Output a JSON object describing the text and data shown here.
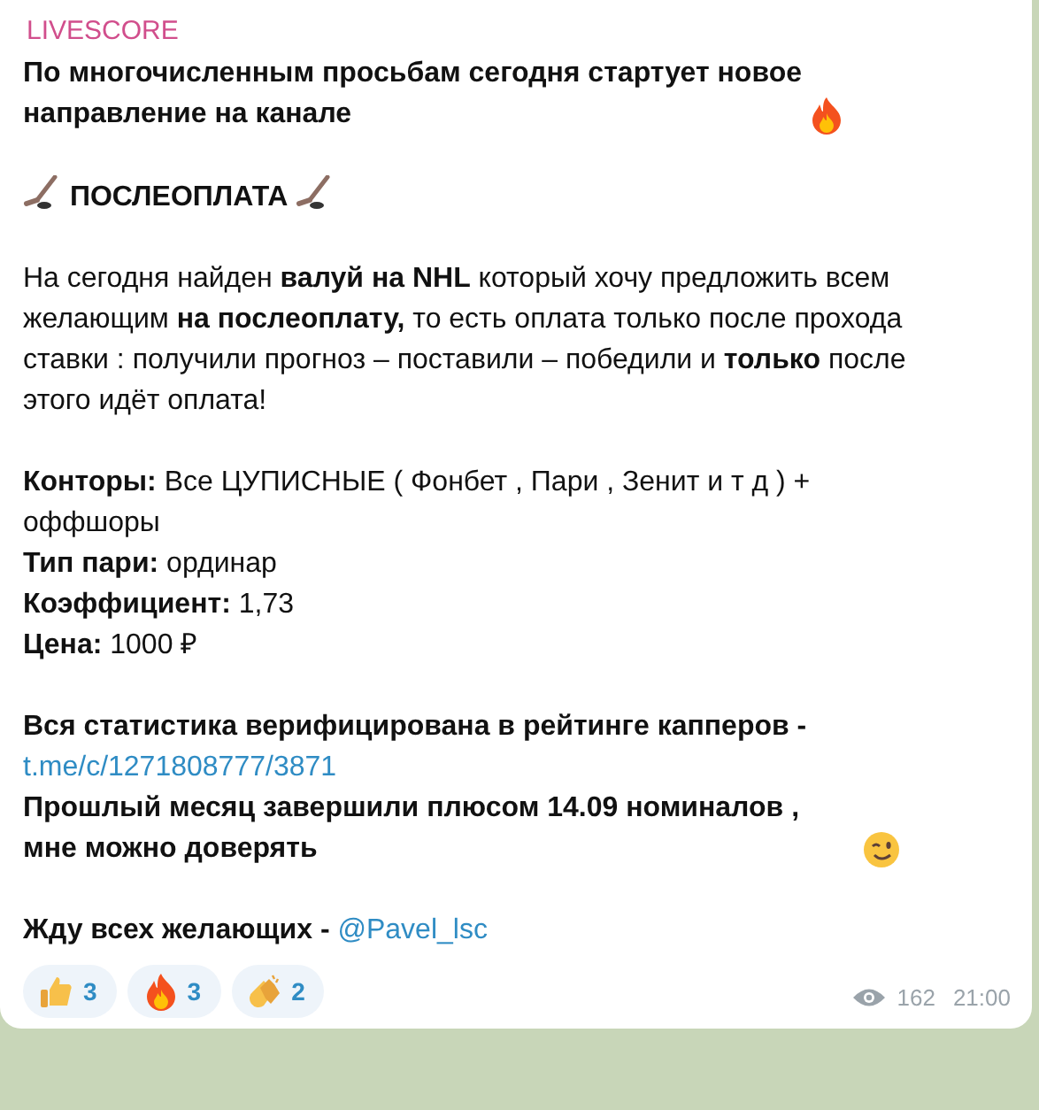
{
  "channel": {
    "name": "LIVESCORE"
  },
  "blocks": [
    {
      "kind": "headline",
      "text": "По многочисленным просьбам  сегодня стартует новое направление на канале"
    },
    {
      "kind": "banner",
      "text": "ПОСЛЕОПЛАТА"
    },
    {
      "kind": "para",
      "text": "На сегодня найден **валуй на NHL** который хочу предложить всем желающим **на послеоплату,** то есть оплата только после прохода ставки : получили прогноз – поставили – победили и **только** после этого идёт оплата!"
    },
    {
      "kind": "fields",
      "items": [
        {
          "label": "Конторы:",
          "value": "Все ЦУПИСНЫЕ ( Фонбет  , Пари , Зенит и т д ) + оффшоры"
        },
        {
          "label": "Тип пари:",
          "value": "ординар"
        },
        {
          "label": "Коэффициент:",
          "value": " 1,73"
        },
        {
          "label": "Цена:",
          "value": "1000 ₽"
        }
      ]
    },
    {
      "kind": "stats",
      "text": "Вся статистика верифицирована в рейтинге капперов -",
      "link": "t.me/c/1271808777/3871",
      "text2": "Прошлый месяц завершили плюсом 14.09 номиналов , мне можно доверять"
    },
    {
      "kind": "contact",
      "text": "Жду всех желающих -",
      "link": "@Pavel_lsc"
    }
  ],
  "reactions": [
    {
      "kind": "thumbs",
      "count": "3"
    },
    {
      "kind": "fire",
      "count": "3"
    },
    {
      "kind": "clap",
      "count": "2"
    }
  ],
  "views": "162",
  "time": "21:00"
}
